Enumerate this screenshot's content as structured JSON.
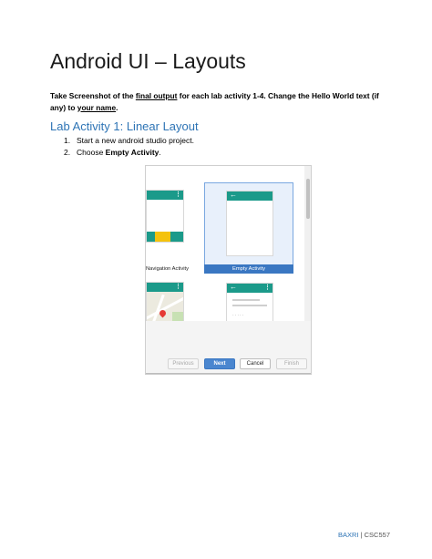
{
  "document": {
    "title": "Android UI – Layouts",
    "instructions": {
      "part1": "Take Screenshot of the ",
      "part2": "final output",
      "part3": " for each lab activity 1-4. Change the Hello World text (if any) to ",
      "part4": "your name",
      "part5": "."
    },
    "section_heading": "Lab Activity 1: Linear Layout",
    "steps": [
      {
        "num": "1.",
        "text": "Start a new android studio project."
      },
      {
        "num": "2.",
        "pre": "Choose ",
        "bold": "Empty Activity",
        "post": "."
      }
    ],
    "footer": {
      "name": "BAXRI",
      "sep": " | ",
      "course": "CSC557"
    }
  },
  "dialog": {
    "templates": [
      {
        "label": "Navigation Activity",
        "selected": false
      },
      {
        "label": "Empty Activity",
        "selected": true
      }
    ],
    "icons": {
      "back": "arrow-left-icon",
      "menu": "more-vert-icon",
      "map_pin": "map-pin-icon"
    },
    "buttons": {
      "previous": "Previous",
      "next": "Next",
      "cancel": "Cancel",
      "finish": "Finish"
    }
  },
  "colors": {
    "heading_blue": "#2e74b5",
    "teal": "#1b9a8a",
    "selection_blue": "#3a77c2",
    "accent_yellow": "#f4c20d"
  }
}
